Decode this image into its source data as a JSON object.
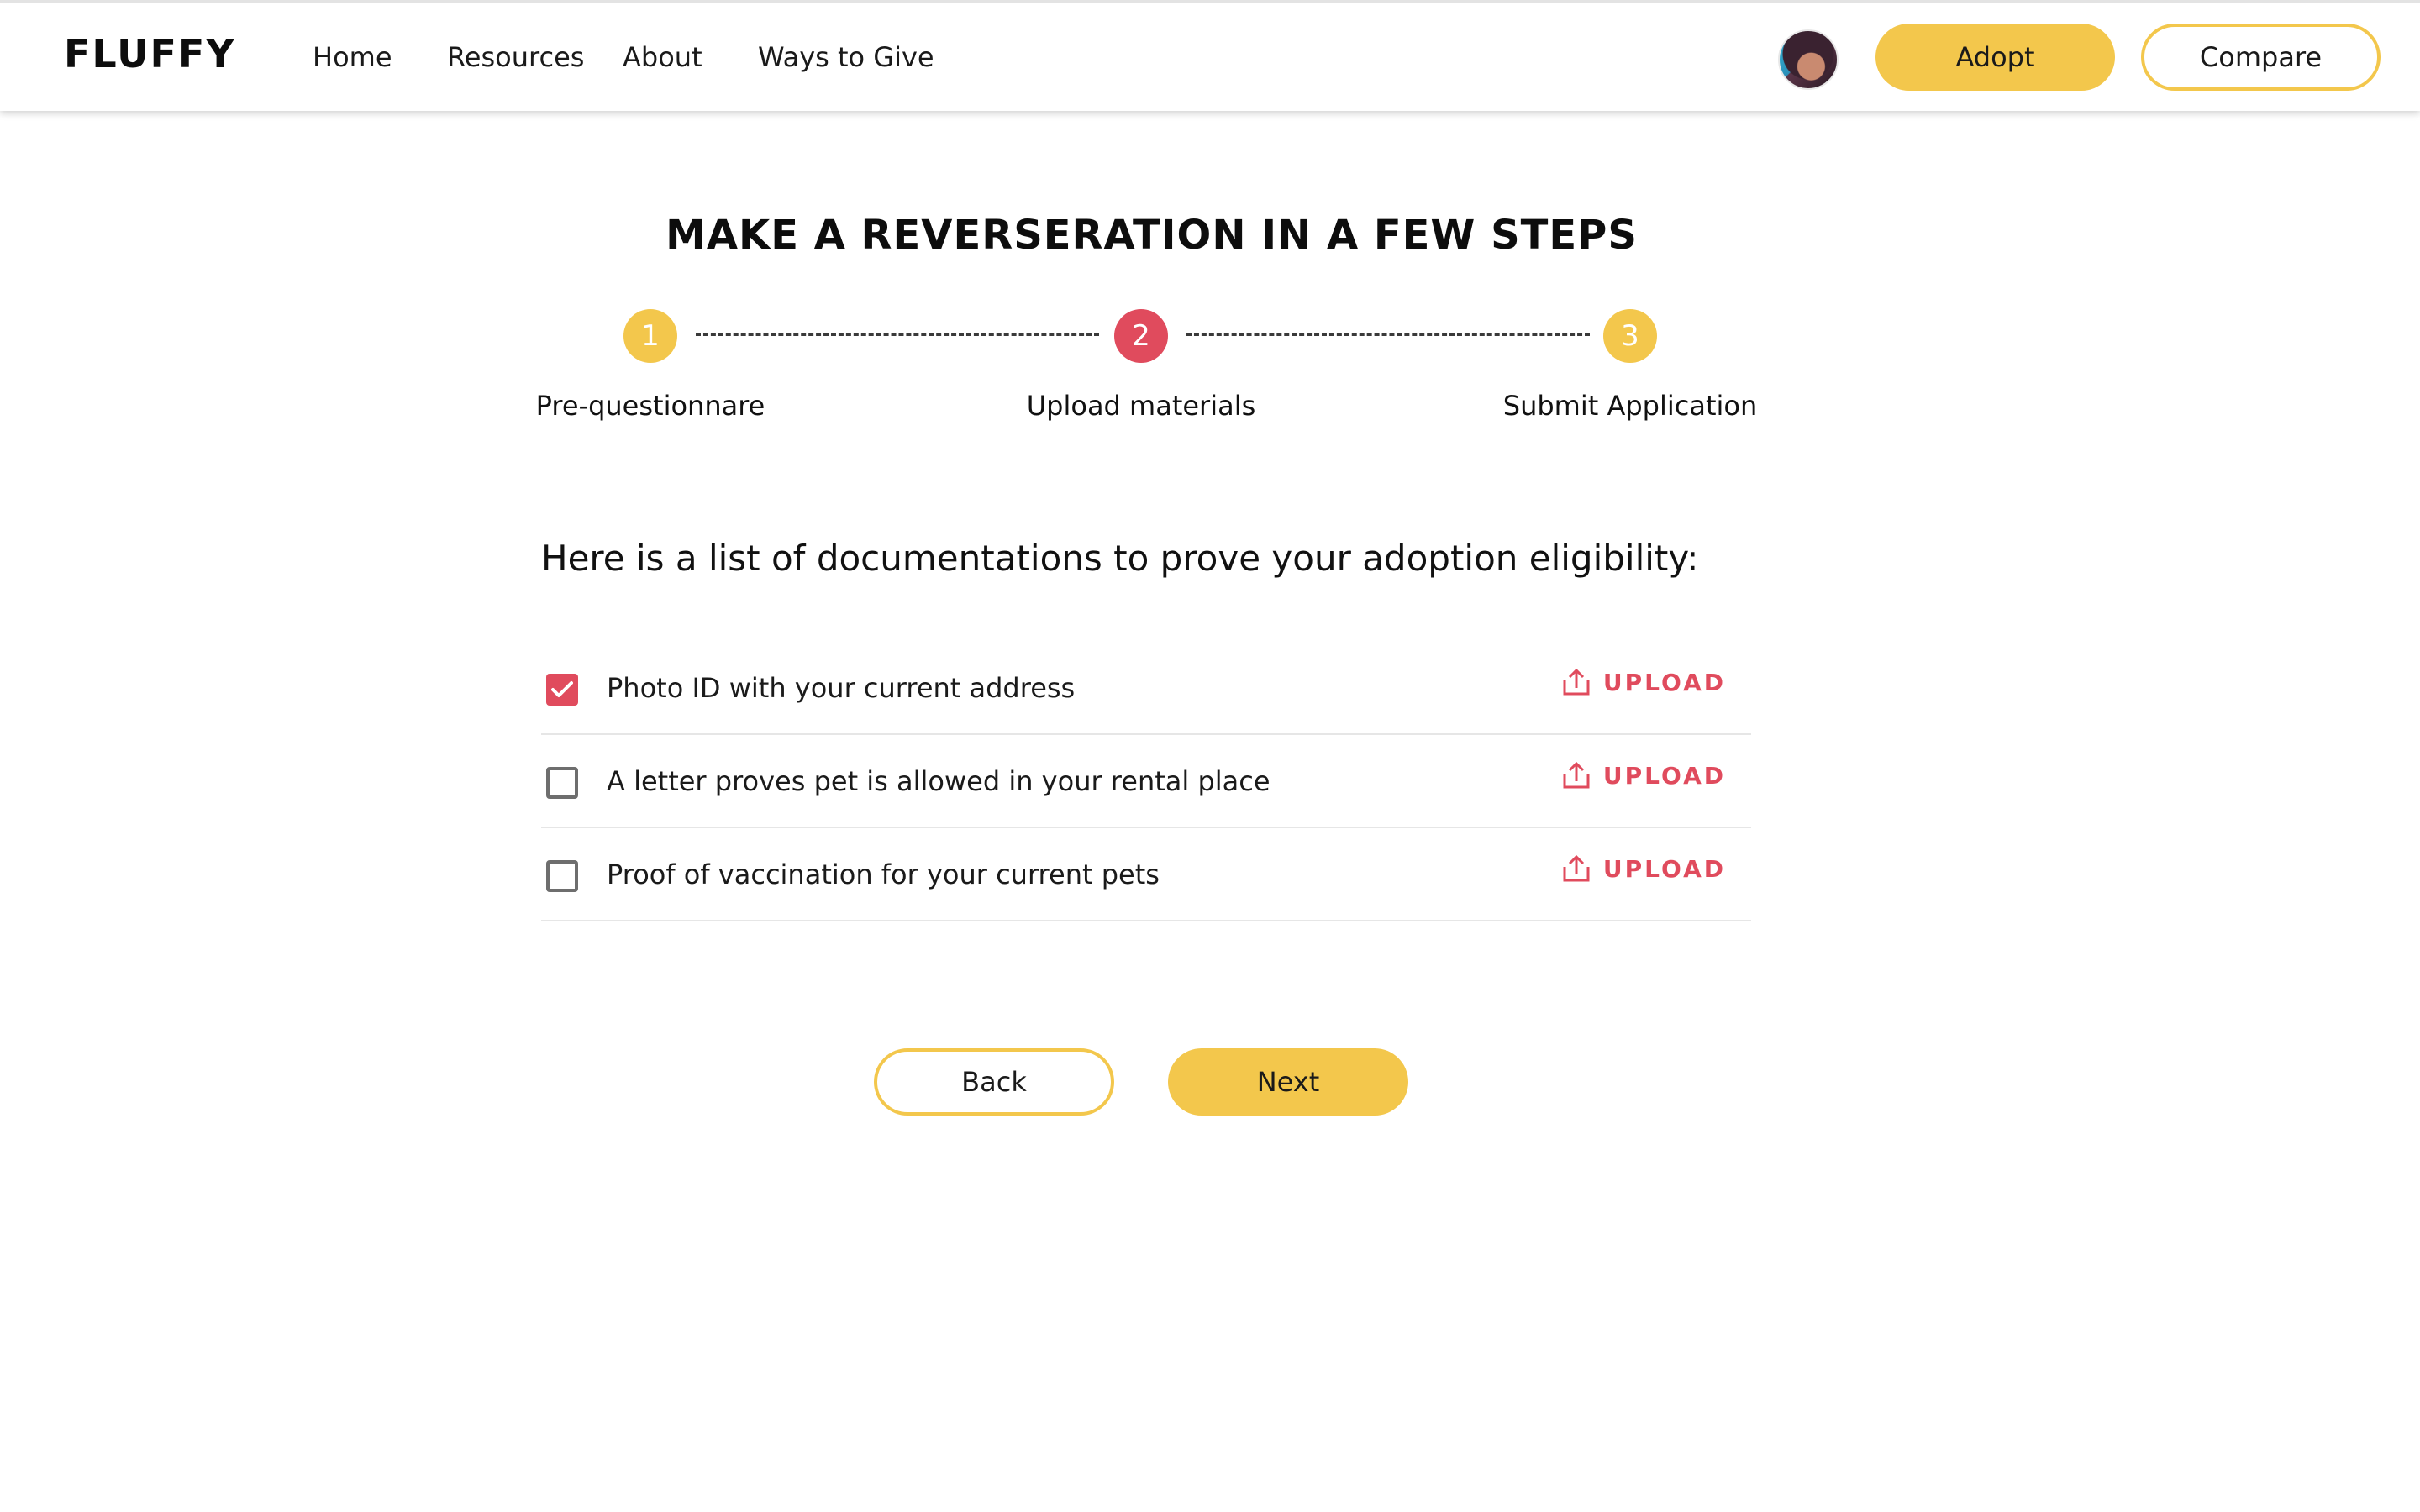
{
  "brand": "FLUFFY",
  "nav": {
    "links": [
      "Home",
      "Resources",
      "About",
      "Ways to Give"
    ],
    "adopt_label": "Adopt",
    "compare_label": "Compare"
  },
  "page_title": "MAKE A REVERSERATION IN A FEW STEPS",
  "steps": [
    {
      "number": "1",
      "label": "Pre-questionnare",
      "color": "#f3c74c"
    },
    {
      "number": "2",
      "label": "Upload materials",
      "color": "#e04b5d"
    },
    {
      "number": "3",
      "label": "Submit Application",
      "color": "#f3c74c"
    }
  ],
  "subheading": "Here is a list of documentations to prove your adoption eligibility:",
  "documents": [
    {
      "label": "Photo ID with your current address",
      "checked": true,
      "action": "UPLOAD"
    },
    {
      "label": "A letter proves pet is allowed in your rental place",
      "checked": false,
      "action": "UPLOAD"
    },
    {
      "label": "Proof of vaccination for your current pets",
      "checked": false,
      "action": "UPLOAD"
    }
  ],
  "buttons": {
    "back": "Back",
    "next": "Next"
  },
  "colors": {
    "accent_yellow": "#f3c74c",
    "accent_red": "#e04b5d"
  },
  "icons": {
    "upload": "upload-icon",
    "check": "check-icon"
  }
}
